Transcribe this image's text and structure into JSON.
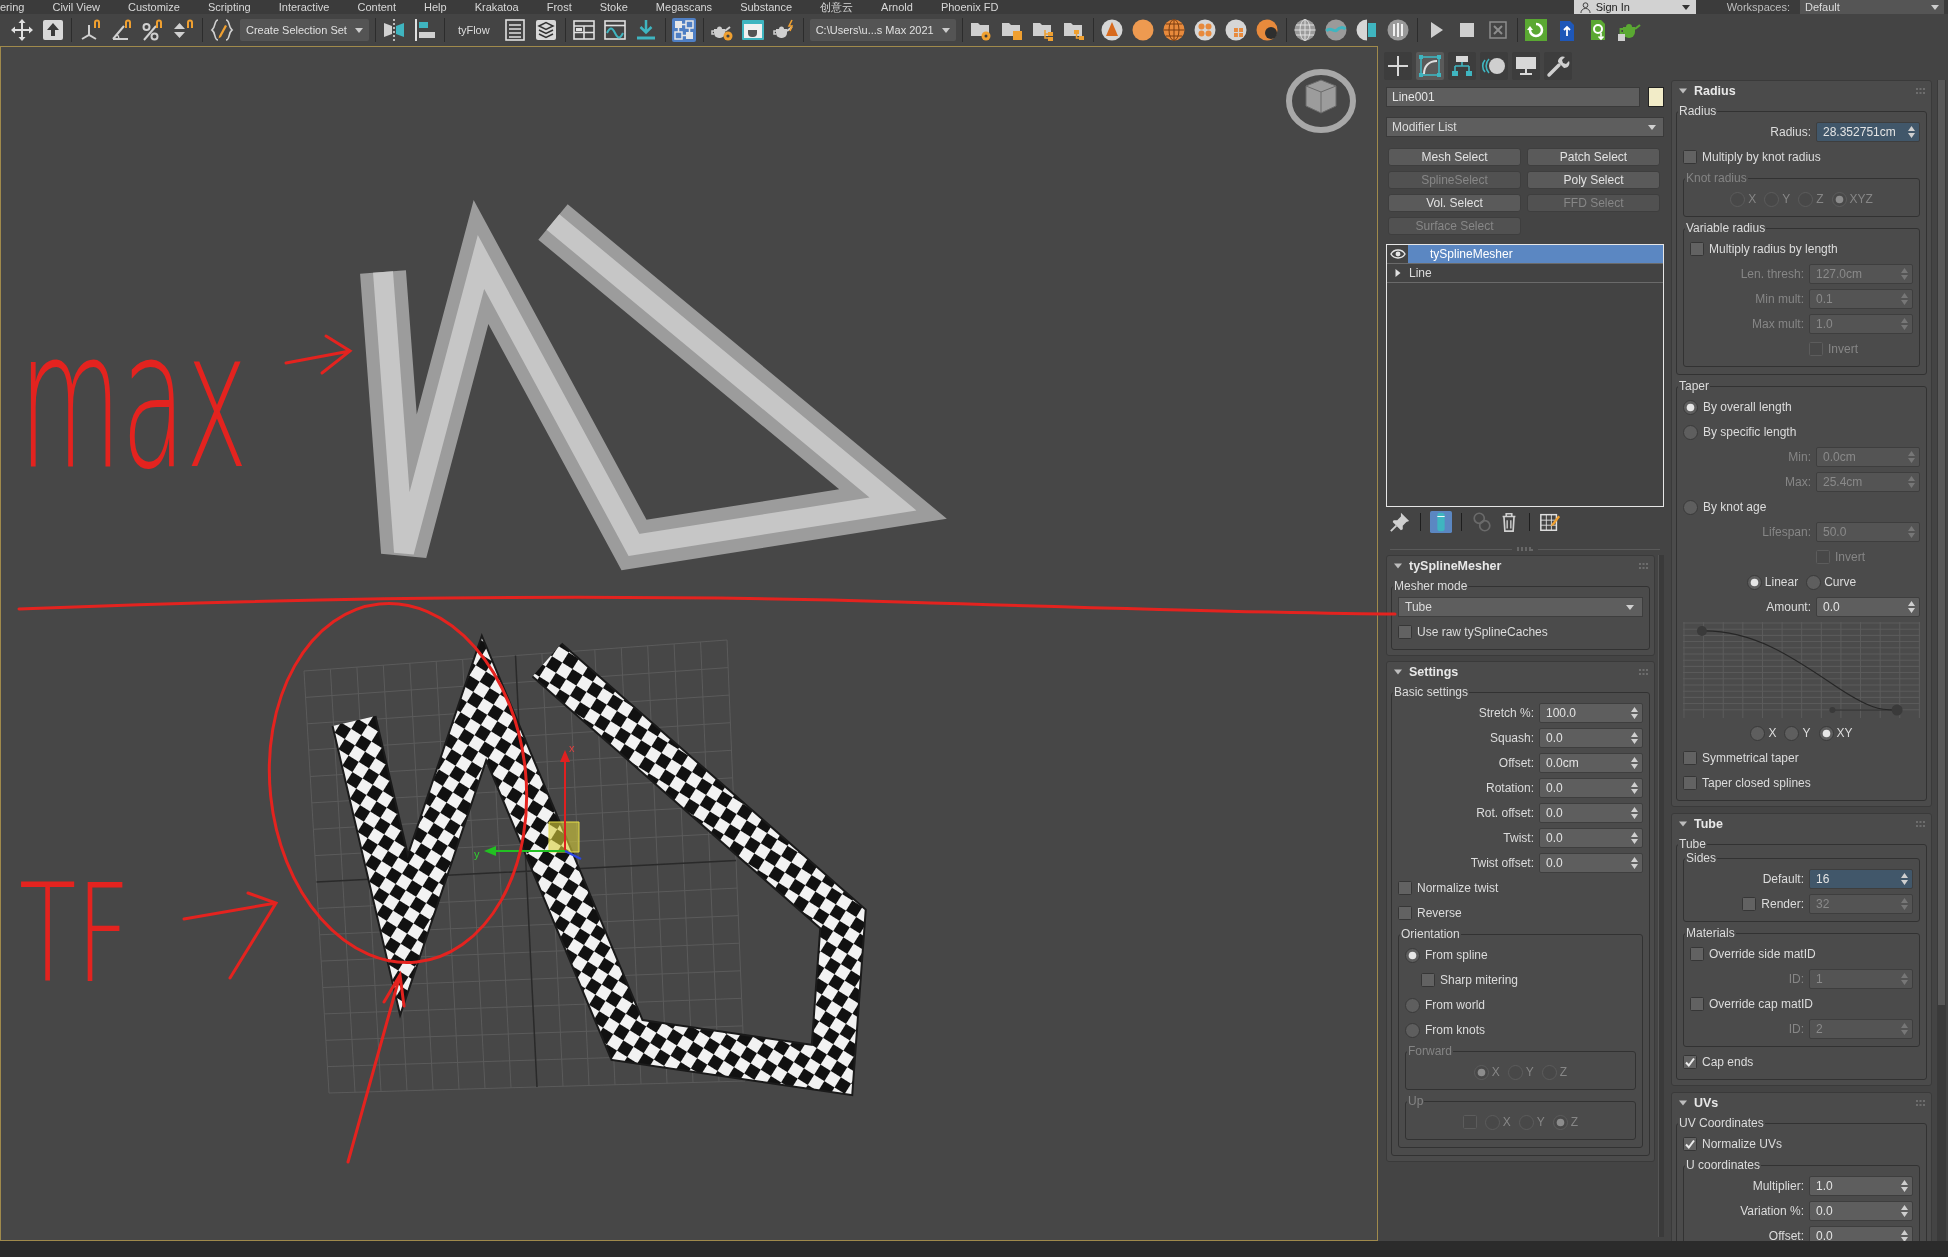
{
  "menu_bar": {
    "items": [
      "ering",
      "Civil View",
      "Customize",
      "Scripting",
      "Interactive",
      "Content",
      "Help",
      "Krakatoa",
      "Frost",
      "Stoke",
      "Megascans",
      "Substance",
      "创意云",
      "Arnold",
      "Phoenix FD"
    ],
    "sign_in": "Sign In",
    "workspaces_label": "Workspaces:",
    "workspace": "Default"
  },
  "toolbar": {
    "groups": [
      [
        {
          "kind": "icon",
          "selected": false
        },
        {
          "kind": "icon",
          "selected": false
        }
      ],
      [
        {
          "kind": "icon",
          "selected": false
        },
        {
          "kind": "icon",
          "selected": false
        },
        {
          "kind": "icon",
          "selected": false
        },
        {
          "kind": "icon",
          "selected": false
        }
      ],
      [
        {
          "kind": "icon",
          "selected": false
        },
        {
          "kind": "dropdown",
          "value": "Create Selection Set"
        }
      ],
      [
        {
          "kind": "icon",
          "selected": false
        },
        {
          "kind": "icon",
          "selected": false
        }
      ],
      [
        {
          "kind": "label",
          "text": "tyFlow"
        },
        {
          "kind": "icon",
          "selected": false
        },
        {
          "kind": "icon",
          "selected": false
        }
      ],
      [
        {
          "kind": "icon",
          "selected": false
        },
        {
          "kind": "icon",
          "selected": false
        },
        {
          "kind": "icon",
          "selected": false
        }
      ],
      [
        {
          "kind": "icon",
          "selected": true
        }
      ],
      [
        {
          "kind": "icon",
          "selected": false
        },
        {
          "kind": "icon",
          "selected": false
        },
        {
          "kind": "icon",
          "selected": false
        }
      ],
      [
        {
          "kind": "dropdown",
          "value": "C:\\Users\\u...s Max 2021"
        }
      ],
      [
        {
          "kind": "icon",
          "selected": false
        },
        {
          "kind": "icon",
          "selected": false
        },
        {
          "kind": "icon",
          "selected": false
        },
        {
          "kind": "icon",
          "selected": false
        }
      ],
      [
        {
          "kind": "icon",
          "selected": false
        },
        {
          "kind": "icon",
          "selected": false
        },
        {
          "kind": "icon",
          "selected": false
        },
        {
          "kind": "icon",
          "selected": false
        },
        {
          "kind": "icon",
          "selected": false
        },
        {
          "kind": "icon",
          "selected": false
        }
      ],
      [
        {
          "kind": "icon",
          "selected": false
        },
        {
          "kind": "icon",
          "selected": false
        },
        {
          "kind": "icon",
          "selected": false
        },
        {
          "kind": "icon",
          "selected": false
        }
      ],
      [
        {
          "kind": "icon",
          "selected": false
        },
        {
          "kind": "icon",
          "selected": false
        },
        {
          "kind": "icon",
          "selected": false
        }
      ],
      [
        {
          "kind": "icon",
          "selected": false
        },
        {
          "kind": "icon",
          "selected": false
        },
        {
          "kind": "icon",
          "selected": false
        },
        {
          "kind": "icon",
          "selected": false
        }
      ]
    ]
  },
  "viewport": {
    "notes": [
      "max",
      "TF"
    ],
    "axis_labels": [
      "x",
      "y"
    ]
  },
  "command_panel": {
    "tabs": [
      {
        "selected": false
      },
      {
        "selected": true
      },
      {
        "selected": false
      },
      {
        "selected": false
      },
      {
        "selected": false
      },
      {
        "selected": false
      }
    ],
    "object_name": {
      "value": "Line001",
      "color": "#f2ecc8"
    },
    "modifier_list": {
      "value": "Modifier List"
    },
    "modifier_buttons": [
      {
        "label": "Mesh Select",
        "disabled": false
      },
      {
        "label": "Patch Select",
        "disabled": false
      },
      {
        "label": "SplineSelect",
        "disabled": true
      },
      {
        "label": "Poly Select",
        "disabled": false
      },
      {
        "label": "Vol. Select",
        "disabled": false
      },
      {
        "label": "FFD Select",
        "disabled": true
      },
      {
        "label": "Surface Select",
        "disabled": true
      }
    ],
    "modifier_stack": [
      {
        "kind": "modifier",
        "label": "tySplineMesher",
        "selected": true,
        "on": true
      },
      {
        "kind": "object",
        "label": "Line",
        "selected": false,
        "expanded": false
      }
    ],
    "stack_tools": [
      {
        "selected": false,
        "disabled": false
      },
      {
        "selected": true,
        "disabled": false
      },
      {
        "selected": false,
        "disabled": true
      },
      {
        "selected": false,
        "disabled": false
      },
      {
        "selected": false,
        "disabled": false
      }
    ],
    "left_rollouts": [
      {
        "title": "tySplineMesher",
        "expanded": true,
        "items": [
          {
            "kind": "group",
            "label": "Mesher mode",
            "disabled": false,
            "items": [
              {
                "kind": "dropdown",
                "value": "Tube"
              },
              {
                "kind": "checkbox",
                "label": "Use raw tySplineCaches",
                "checked": false,
                "disabled": false
              }
            ]
          }
        ]
      },
      {
        "title": "Settings",
        "expanded": true,
        "items": [
          {
            "kind": "group",
            "label": "Basic settings",
            "disabled": false,
            "items": [
              {
                "kind": "spinner",
                "label": "Stretch %:",
                "value": "100.0",
                "disabled": false,
                "focused": false
              },
              {
                "kind": "spinner",
                "label": "Squash:",
                "value": "0.0",
                "disabled": false,
                "focused": false
              },
              {
                "kind": "spinner",
                "label": "Offset:",
                "value": "0.0cm",
                "disabled": false,
                "focused": false
              },
              {
                "kind": "spinner",
                "label": "Rotation:",
                "value": "0.0",
                "disabled": false,
                "focused": false
              },
              {
                "kind": "spinner",
                "label": "Rot. offset:",
                "value": "0.0",
                "disabled": false,
                "focused": false
              },
              {
                "kind": "spinner",
                "label": "Twist:",
                "value": "0.0",
                "disabled": false,
                "focused": false
              },
              {
                "kind": "spinner",
                "label": "Twist offset:",
                "value": "0.0",
                "disabled": false,
                "focused": false
              },
              {
                "kind": "checkbox",
                "label": "Normalize twist",
                "checked": false,
                "disabled": false
              },
              {
                "kind": "checkbox",
                "label": "Reverse",
                "checked": false,
                "disabled": false
              },
              {
                "kind": "group",
                "label": "Orientation",
                "disabled": false,
                "items": [
                  {
                    "kind": "radio",
                    "label": "From spline",
                    "selected": true,
                    "disabled": false,
                    "children": [
                      {
                        "kind": "checkbox",
                        "label": "Sharp mitering",
                        "checked": false,
                        "disabled": false
                      }
                    ]
                  },
                  {
                    "kind": "radio",
                    "label": "From world",
                    "selected": false,
                    "disabled": false
                  },
                  {
                    "kind": "radio",
                    "label": "From knots",
                    "selected": false,
                    "disabled": false
                  },
                  {
                    "kind": "group",
                    "label": "Forward",
                    "disabled": true,
                    "items": [
                      {
                        "kind": "row",
                        "items": [
                          {
                            "kind": "radio",
                            "label": "X",
                            "selected": true,
                            "disabled": true
                          },
                          {
                            "kind": "radio",
                            "label": "Y",
                            "selected": false,
                            "disabled": true
                          },
                          {
                            "kind": "radio",
                            "label": "Z",
                            "selected": false,
                            "disabled": true
                          }
                        ]
                      }
                    ]
                  },
                  {
                    "kind": "group",
                    "label": "Up",
                    "disabled": true,
                    "items": [
                      {
                        "kind": "row",
                        "items": [
                          {
                            "kind": "checkbox",
                            "checked": false,
                            "disabled": true
                          },
                          {
                            "kind": "radio",
                            "label": "X",
                            "selected": false,
                            "disabled": true
                          },
                          {
                            "kind": "radio",
                            "label": "Y",
                            "selected": false,
                            "disabled": true
                          },
                          {
                            "kind": "radio",
                            "label": "Z",
                            "selected": true,
                            "disabled": true
                          }
                        ]
                      }
                    ]
                  }
                ]
              }
            ]
          }
        ]
      }
    ],
    "right_rollouts": [
      {
        "title": "Radius",
        "expanded": true,
        "items": [
          {
            "kind": "group",
            "label": "Radius",
            "disabled": false,
            "items": [
              {
                "kind": "spinner",
                "label": "Radius:",
                "value": "28.352751cm",
                "disabled": false,
                "focused": true
              },
              {
                "kind": "checkbox",
                "label": "Multiply by knot radius",
                "checked": false,
                "disabled": false
              },
              {
                "kind": "group",
                "label": "Knot radius",
                "disabled": true,
                "items": [
                  {
                    "kind": "row",
                    "items": [
                      {
                        "kind": "radio",
                        "label": "X",
                        "selected": false,
                        "disabled": true
                      },
                      {
                        "kind": "radio",
                        "label": "Y",
                        "selected": false,
                        "disabled": true
                      },
                      {
                        "kind": "radio",
                        "label": "Z",
                        "selected": false,
                        "disabled": true
                      },
                      {
                        "kind": "radio",
                        "label": "XYZ",
                        "selected": true,
                        "disabled": true
                      }
                    ]
                  }
                ]
              },
              {
                "kind": "group",
                "label": "Variable radius",
                "disabled": false,
                "items": [
                  {
                    "kind": "checkbox",
                    "label": "Multiply radius by length",
                    "checked": false,
                    "disabled": false
                  },
                  {
                    "kind": "spinner",
                    "label": "Len. thresh:",
                    "value": "127.0cm",
                    "disabled": true,
                    "focused": false
                  },
                  {
                    "kind": "spinner",
                    "label": "Min mult:",
                    "value": "0.1",
                    "disabled": true,
                    "focused": false
                  },
                  {
                    "kind": "spinner",
                    "label": "Max mult:",
                    "value": "1.0",
                    "disabled": true,
                    "focused": false
                  },
                  {
                    "kind": "field_checkbox",
                    "label": "Invert",
                    "checked": false,
                    "disabled": true
                  }
                ]
              }
            ]
          },
          {
            "kind": "group",
            "label": "Taper",
            "disabled": false,
            "items": [
              {
                "kind": "radio",
                "label": "By overall length",
                "selected": true,
                "disabled": false
              },
              {
                "kind": "radio",
                "label": "By specific length",
                "selected": false,
                "disabled": false,
                "children": [
                  {
                    "kind": "spinner",
                    "label": "Min:",
                    "value": "0.0cm",
                    "disabled": true,
                    "focused": false
                  },
                  {
                    "kind": "spinner",
                    "label": "Max:",
                    "value": "25.4cm",
                    "disabled": true,
                    "focused": false
                  }
                ]
              },
              {
                "kind": "radio",
                "label": "By knot age",
                "selected": false,
                "disabled": false,
                "children": [
                  {
                    "kind": "spinner",
                    "label": "Lifespan:",
                    "value": "50.0",
                    "disabled": true,
                    "focused": false
                  },
                  {
                    "kind": "field_checkbox",
                    "label": "Invert",
                    "checked": false,
                    "disabled": true
                  }
                ]
              },
              {
                "kind": "row",
                "items": [
                  {
                    "kind": "radio",
                    "label": "Linear",
                    "selected": true,
                    "disabled": false
                  },
                  {
                    "kind": "radio",
                    "label": "Curve",
                    "selected": false,
                    "disabled": false
                  }
                ]
              },
              {
                "kind": "spinner",
                "label": "Amount:",
                "value": "0.0",
                "disabled": false,
                "focused": false
              },
              {
                "kind": "graph"
              },
              {
                "kind": "row",
                "items": [
                  {
                    "kind": "radio",
                    "label": "X",
                    "selected": false,
                    "disabled": false
                  },
                  {
                    "kind": "radio",
                    "label": "Y",
                    "selected": false,
                    "disabled": false
                  },
                  {
                    "kind": "radio",
                    "label": "XY",
                    "selected": true,
                    "disabled": false
                  }
                ]
              },
              {
                "kind": "checkbox",
                "label": "Symmetrical taper",
                "checked": false,
                "disabled": false
              },
              {
                "kind": "checkbox",
                "label": "Taper closed splines",
                "checked": false,
                "disabled": false
              }
            ]
          }
        ]
      },
      {
        "title": "Tube",
        "expanded": true,
        "items": [
          {
            "kind": "group",
            "label": "Tube",
            "disabled": false,
            "items": [
              {
                "kind": "group",
                "label": "Sides",
                "disabled": false,
                "items": [
                  {
                    "kind": "spinner",
                    "label": "Default:",
                    "value": "16",
                    "disabled": false,
                    "focused": true
                  },
                  {
                    "kind": "check_spinner",
                    "label": "Render:",
                    "value": "32",
                    "checked": false,
                    "disabled": true,
                    "focused": false
                  }
                ]
              },
              {
                "kind": "group",
                "label": "Materials",
                "disabled": false,
                "items": [
                  {
                    "kind": "checkbox",
                    "label": "Override side matID",
                    "checked": false,
                    "disabled": false
                  },
                  {
                    "kind": "spinner",
                    "label": "ID:",
                    "value": "1",
                    "disabled": true,
                    "focused": false
                  },
                  {
                    "kind": "checkbox",
                    "label": "Override cap matID",
                    "checked": false,
                    "disabled": false
                  },
                  {
                    "kind": "spinner",
                    "label": "ID:",
                    "value": "2",
                    "disabled": true,
                    "focused": false
                  }
                ]
              },
              {
                "kind": "checkbox",
                "label": "Cap ends",
                "checked": true,
                "disabled": false
              }
            ]
          }
        ]
      },
      {
        "title": "UVs",
        "expanded": true,
        "items": [
          {
            "kind": "group",
            "label": "UV Coordinates",
            "disabled": false,
            "items": [
              {
                "kind": "checkbox",
                "label": "Normalize UVs",
                "checked": true,
                "disabled": false
              },
              {
                "kind": "group",
                "label": "U coordinates",
                "disabled": false,
                "items": [
                  {
                    "kind": "spinner",
                    "label": "Multiplier:",
                    "value": "1.0",
                    "disabled": false,
                    "focused": false
                  },
                  {
                    "kind": "spinner",
                    "label": "Variation %:",
                    "value": "0.0",
                    "disabled": false,
                    "focused": false
                  },
                  {
                    "kind": "spinner",
                    "label": "Offset:",
                    "value": "0.0",
                    "disabled": false,
                    "focused": false
                  }
                ]
              }
            ]
          }
        ]
      }
    ]
  }
}
